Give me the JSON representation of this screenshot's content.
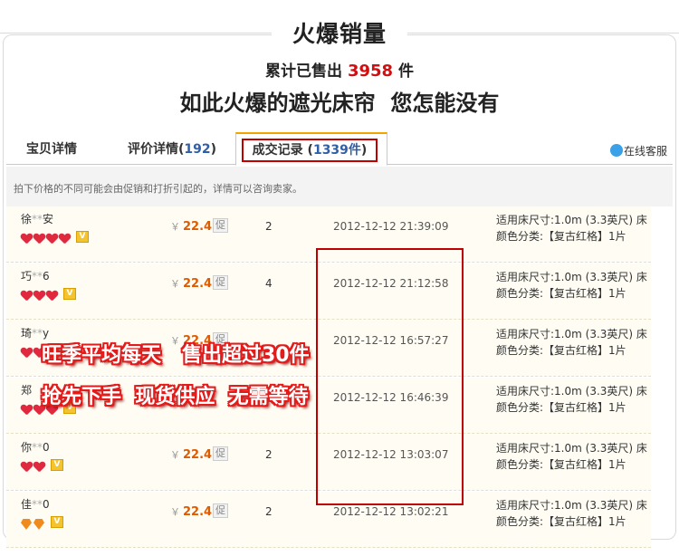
{
  "header": {
    "title": "火爆销量",
    "sold_prefix": "累计已售出",
    "sold_count": "3958",
    "sold_unit": "件",
    "slogan": "如此火爆的遮光床帘  您怎能没有"
  },
  "tabs": [
    {
      "label": "宝贝详情",
      "count": ""
    },
    {
      "label": "评价详情",
      "count_prefix": "(",
      "count": "192",
      "count_suffix": ")"
    },
    {
      "label": "成交记录 ",
      "count_prefix": "(",
      "count": "1339件",
      "count_suffix": ")"
    }
  ],
  "service_label": "在线客服",
  "notice": "拍下价格的不同可能会由促销和打折引起的，详情可以咨询卖家。",
  "currency": "￥",
  "promo_badge": "促",
  "records": [
    {
      "buyer": "徐",
      "mask": "**",
      "buyer_end": "安",
      "rank": "hearts",
      "rank_count": 4,
      "price": "22.4",
      "qty": "2",
      "time": "2012-12-12 21:39:09",
      "spec_size": "适用床尺寸:1.0m (3.3英尺) 床",
      "spec_color": "颜色分类:【复古红格】1片"
    },
    {
      "buyer": "巧",
      "mask": "**",
      "buyer_end": "6",
      "rank": "hearts",
      "rank_count": 3,
      "price": "22.4",
      "qty": "4",
      "time": "2012-12-12 21:12:58",
      "spec_size": "适用床尺寸:1.0m (3.3英尺) 床",
      "spec_color": "颜色分类:【复古红格】1片"
    },
    {
      "buyer": "琦",
      "mask": "**",
      "buyer_end": "y",
      "rank": "hearts",
      "rank_count": 3,
      "price": "22.4",
      "qty": "",
      "time": "2012-12-12 16:57:27",
      "spec_size": "适用床尺寸:1.0m (3.3英尺) 床",
      "spec_color": "颜色分类:【复古红格】1片"
    },
    {
      "buyer": "郑",
      "mask": "",
      "buyer_end": "",
      "rank": "hearts",
      "rank_count": 3,
      "price": "",
      "qty": "",
      "time": "2012-12-12 16:46:39",
      "spec_size": "适用床尺寸:1.0m (3.3英尺) 床",
      "spec_color": "颜色分类:【复古红格】1片"
    },
    {
      "buyer": "你",
      "mask": "**",
      "buyer_end": "0",
      "rank": "hearts",
      "rank_count": 2,
      "price": "22.4",
      "qty": "2",
      "time": "2012-12-12 13:03:07",
      "spec_size": "适用床尺寸:1.0m (3.3英尺) 床",
      "spec_color": "颜色分类:【复古红格】1片"
    },
    {
      "buyer": "佳",
      "mask": "**",
      "buyer_end": "0",
      "rank": "diamonds",
      "rank_count": 2,
      "price": "22.4",
      "qty": "2",
      "time": "2012-12-12 13:02:21",
      "spec_size": "适用床尺寸:1.0m (3.3英尺) 床",
      "spec_color": "颜色分类:【复古红格】1片"
    }
  ],
  "promo_overlay": {
    "line1": "旺季平均每天   售出超过30件",
    "line2": "抢先下手  现货供应  无需等待"
  },
  "colors": {
    "accent_red": "#c00000",
    "price_orange": "#e05a00",
    "count_blue": "#2f5fa8"
  }
}
